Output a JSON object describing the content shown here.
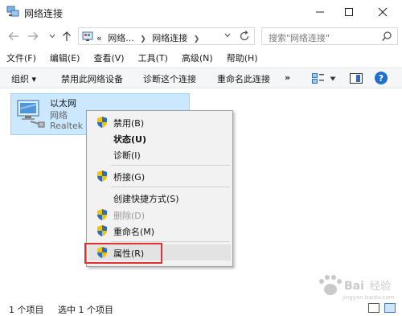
{
  "window": {
    "title": "网络连接"
  },
  "address": {
    "crumbs": [
      "«",
      "网络...",
      "网络连接"
    ]
  },
  "search": {
    "placeholder": "搜索\"网络连接\""
  },
  "menubar": {
    "items": [
      "文件(F)",
      "编辑(E)",
      "查看(V)",
      "工具(T)",
      "高级(N)",
      "帮助(H)"
    ]
  },
  "commandbar": {
    "organize": "组织 ▾",
    "disable": "禁用此网络设备",
    "diagnose": "诊断这个连接",
    "rename": "重命名此连接",
    "more": "»",
    "help": "?"
  },
  "item": {
    "name": "以太网",
    "status": "网络",
    "device": "Realtek P"
  },
  "context_menu": {
    "items": [
      {
        "label": "禁用(B)",
        "shield": true,
        "bold": false,
        "disabled": false
      },
      {
        "label": "状态(U)",
        "shield": false,
        "bold": true,
        "disabled": false
      },
      {
        "label": "诊断(I)",
        "shield": false,
        "bold": false,
        "disabled": false
      },
      {
        "label": "桥接(G)",
        "shield": true,
        "bold": false,
        "disabled": false
      },
      {
        "label": "创建快捷方式(S)",
        "shield": false,
        "bold": false,
        "disabled": false
      },
      {
        "label": "删除(D)",
        "shield": true,
        "bold": false,
        "disabled": true
      },
      {
        "label": "重命名(M)",
        "shield": true,
        "bold": false,
        "disabled": false
      },
      {
        "label": "属性(R)",
        "shield": true,
        "bold": false,
        "disabled": false
      }
    ]
  },
  "status": {
    "count": "1 个项目",
    "selected": "选中 1 个项目"
  },
  "colors": {
    "selection": "#cce8ff",
    "highlight_box": "#e0312f",
    "shield_blue": "#2b6cc4",
    "shield_yellow": "#f2c500"
  },
  "watermark": {
    "text": "Baidu 经验",
    "sub": "jingyan.baidu.com"
  }
}
